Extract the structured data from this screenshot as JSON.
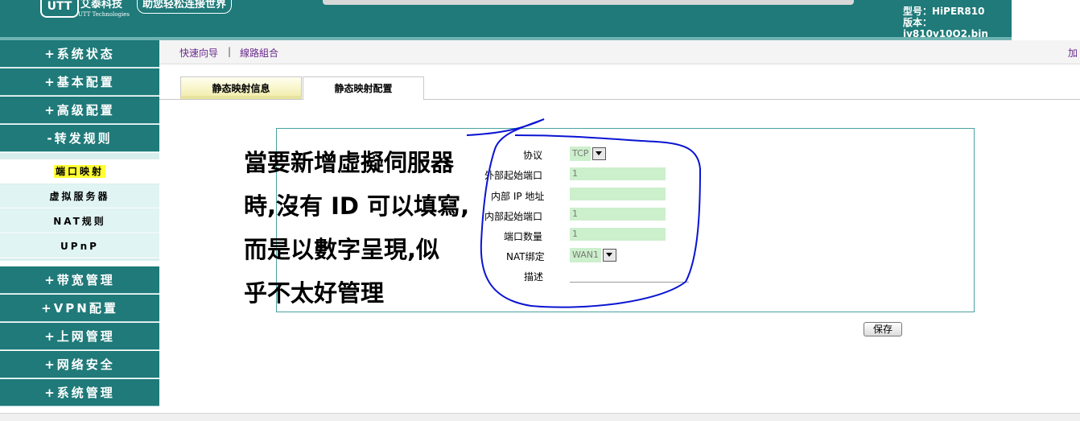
{
  "header": {
    "logo": "UTT",
    "brand_cn": "艾泰科技",
    "brand_en": "UTT Technologies",
    "slogan": "助您轻松连接世界",
    "model_line": "型号：HiPER810",
    "version_line": "版本：iv810v10Q2.bin"
  },
  "sidebar": {
    "menu": [
      {
        "label": "+系统状态"
      },
      {
        "label": "+基本配置"
      },
      {
        "label": "+高级配置"
      },
      {
        "label": "-转发规则"
      }
    ],
    "submenu": [
      {
        "label": "端口映射",
        "active": true
      },
      {
        "label": "虚拟服务器",
        "active": false
      },
      {
        "label": "NAT规则",
        "active": false
      },
      {
        "label": "UPnP",
        "active": false
      }
    ],
    "menu2": [
      {
        "label": "+带宽管理"
      },
      {
        "label": "+VPN配置"
      },
      {
        "label": "+上网管理"
      },
      {
        "label": "+网络安全"
      },
      {
        "label": "+系统管理"
      }
    ]
  },
  "breadcrumb": {
    "link1": "快速向导",
    "separator": "|",
    "link2": "線路組合",
    "right_link": "加"
  },
  "tabs": [
    {
      "label": "静态映射信息"
    },
    {
      "label": "静态映射配置"
    }
  ],
  "form": {
    "protocol_label": "协议",
    "protocol_value": "TCP",
    "ext_port_label": "外部起始端口",
    "ext_port_value": "1",
    "ip_label": "内部 IP 地址",
    "ip_value": "",
    "int_port_label": "内部起始端口",
    "int_port_value": "1",
    "count_label": "端口数量",
    "count_value": "1",
    "nat_label": "NAT绑定",
    "nat_value": "WAN1",
    "desc_label": "描述",
    "desc_value": ""
  },
  "save_label": "保存",
  "annotation": {
    "lines": [
      "當要新增虛擬伺服器",
      "時,沒有 ID 可以填寫,",
      "而是以數字呈現,似",
      "乎不太好管理"
    ]
  },
  "colors": {
    "teal": "#1f7a79",
    "highlight": "#ffff33",
    "input_green": "#ccefcc",
    "ink_blue": "#0a14d2"
  }
}
